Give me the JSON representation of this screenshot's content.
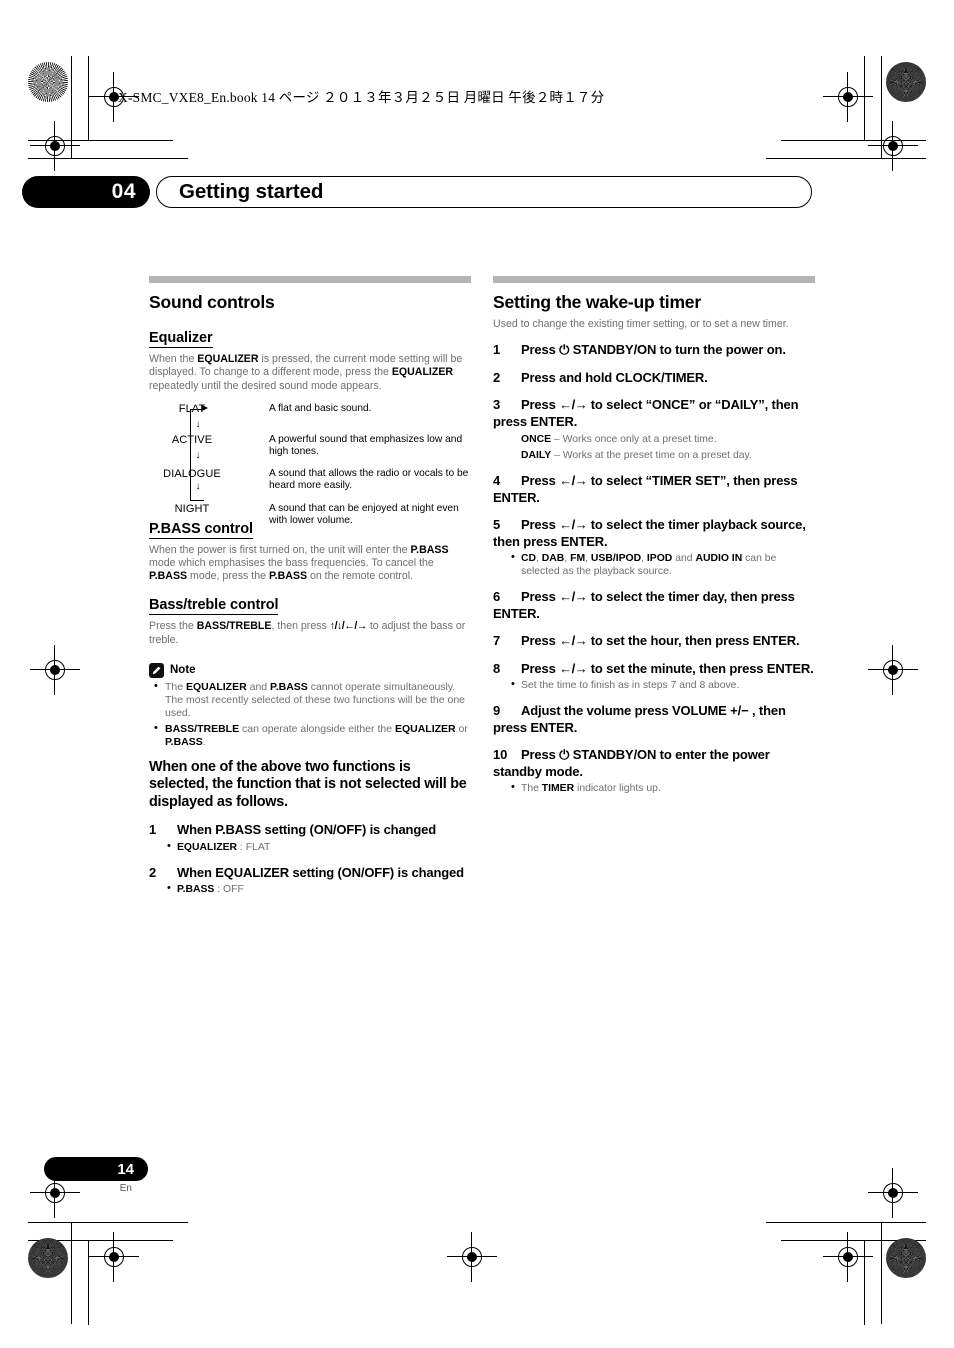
{
  "header": {
    "file_line": "X-SMC_VXE8_En.book   14 ページ   ２０１３年３月２５日   月曜日   午後２時１７分"
  },
  "chapter": {
    "number": "04",
    "title": "Getting started"
  },
  "left_column": {
    "section_title": "Sound controls",
    "equalizer": {
      "heading": "Equalizer",
      "intro_1": "When the ",
      "intro_b1": "EQUALIZER",
      "intro_2": " is pressed, the current mode setting will be displayed. To change to a different mode, press the ",
      "intro_b2": "EQUALIZER",
      "intro_3": " repeatedly until the desired sound mode appears.",
      "modes": [
        {
          "name": "FLAT",
          "desc": "A flat and basic sound."
        },
        {
          "name": "ACTIVE",
          "desc": "A powerful sound that emphasizes low and high tones."
        },
        {
          "name": "DIALOGUE",
          "desc": "A sound that allows the radio or vocals to be heard more easily."
        },
        {
          "name": "NIGHT",
          "desc": "A sound that can be enjoyed at night even with lower volume."
        }
      ],
      "arrow_glyph": "↓"
    },
    "pbass": {
      "heading": "P.BASS control",
      "t1": "When the power is first turned on, the unit will enter the ",
      "b1": "P.BASS",
      "t2": " mode which emphasises the bass frequencies. To cancel the ",
      "b2": "P.BASS",
      "t3": " mode, press the ",
      "b3": "P.BASS",
      "t4": " on the remote control."
    },
    "bass_treble": {
      "heading": "Bass/treble control",
      "t1": "Press the ",
      "b1": "BASS/TREBLE",
      "t2": ", then press ",
      "arrows": "↑/↓/←/→",
      "t3": " to adjust the bass or treble."
    },
    "note": {
      "title": "Note",
      "icon": "pencil-icon",
      "items": [
        {
          "t1": "The ",
          "b1": "EQUALIZER",
          "t2": " and ",
          "b2": "P.BASS",
          "t3": " cannot operate simultaneously. The most recently selected of these two functions will be the one used."
        },
        {
          "t1": "",
          "b1": "BASS/TREBLE",
          "t2": " can operate alongside either the ",
          "b2": "EQUALIZER",
          "t3": " or ",
          "b3": "P.BASS",
          "t4": "."
        }
      ]
    },
    "lead": "When one of the above two functions is selected, the function that is not selected will be displayed as follows.",
    "steps": [
      {
        "num": "1",
        "text": "When P.BASS setting (ON/OFF) is changed",
        "bullet_bold": "EQUALIZER",
        "bullet_rest": " : FLAT"
      },
      {
        "num": "2",
        "text": "When EQUALIZER setting (ON/OFF) is changed",
        "bullet_bold": "P.BASS",
        "bullet_rest": " : OFF"
      }
    ]
  },
  "right_column": {
    "section_title": "Setting the wake-up timer",
    "intro": "Used to change the existing timer setting, or to set a new timer.",
    "power_glyph": "⏻",
    "steps": [
      {
        "num": "1",
        "text_a": "Press ",
        "glyph": "⏻",
        "text_b": " STANDBY/ON to turn the power on."
      },
      {
        "num": "2",
        "text_a": "Press and hold CLOCK/TIMER.",
        "glyph": "",
        "text_b": ""
      },
      {
        "num": "3",
        "text_a": "Press ",
        "glyph": "←/→",
        "text_b": " to select “ONCE” or “DAILY”, then press ENTER."
      },
      {
        "num": "4",
        "text_a": "Press ",
        "glyph": "←/→",
        "text_b": " to select “TIMER SET”, then press ENTER."
      },
      {
        "num": "5",
        "text_a": "Press ",
        "glyph": "←/→",
        "text_b": " to select the timer playback source, then press ENTER."
      },
      {
        "num": "6",
        "text_a": "Press ",
        "glyph": "←/→",
        "text_b": " to select the timer day, then press ENTER."
      },
      {
        "num": "7",
        "text_a": "Press ",
        "glyph": "←/→",
        "text_b": " to set the hour, then press ENTER."
      },
      {
        "num": "8",
        "text_a": "Press ",
        "glyph": "←/→",
        "text_b": " to set the minute, then press ENTER."
      },
      {
        "num": "9",
        "text_a": "Adjust the volume press VOLUME +/− , then press ENTER.",
        "glyph": "",
        "text_b": ""
      },
      {
        "num": "10",
        "text_a": "Press ",
        "glyph": "⏻",
        "text_b": " STANDBY/ON to enter the power standby mode."
      }
    ],
    "step3_defs": [
      {
        "term": "ONCE",
        "desc": " – Works once only at a preset time."
      },
      {
        "term": "DAILY",
        "desc": " – Works at the preset time on a preset day."
      }
    ],
    "step5_note": {
      "b1": "CD",
      "s1": ", ",
      "b2": "DAB",
      "s2": ", ",
      "b3": "FM",
      "s3": ", ",
      "b4": "USB/IPOD",
      "s4": ", ",
      "b5": "IPOD",
      "s5": " and ",
      "b6": "AUDIO IN",
      "s6": " can be selected as the playback source."
    },
    "step8_note": "Set the time to finish as in steps 7 and 8 above.",
    "step10_note": {
      "t1": "The ",
      "b1": "TIMER",
      "t2": " indicator lights up."
    }
  },
  "footer": {
    "page_number": "14",
    "language": "En"
  }
}
